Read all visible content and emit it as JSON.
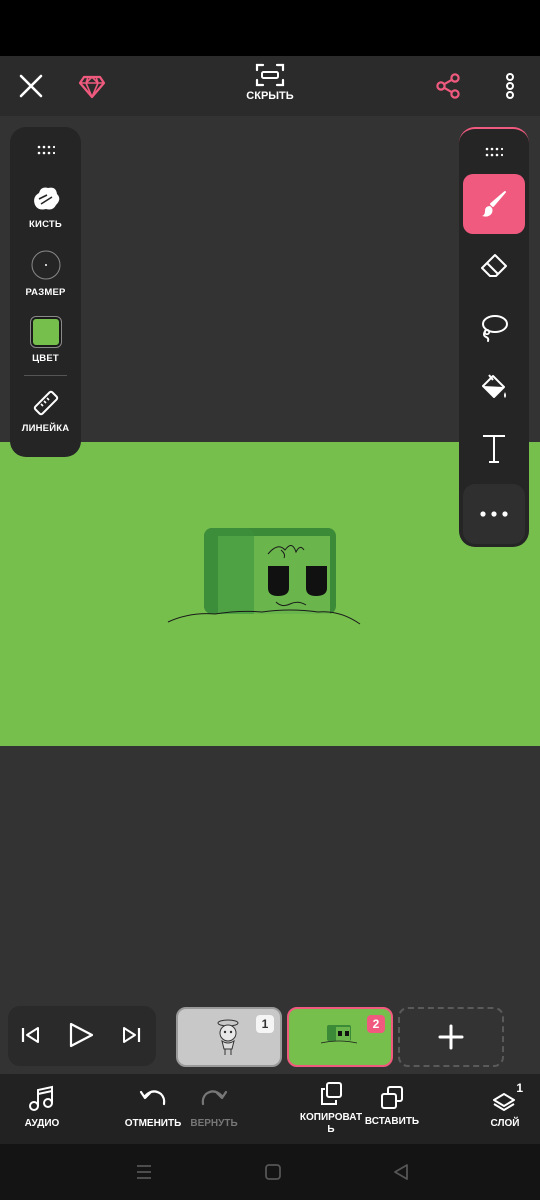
{
  "top_bar": {
    "close_icon": "close-icon",
    "premium_icon": "gem-icon",
    "hide_label": "СКРЫТЬ",
    "share_icon": "share-icon",
    "menu_icon": "more-vert-icon"
  },
  "left_tools": {
    "brush_label": "КИСТЬ",
    "size_label": "РАЗМЕР",
    "color_label": "ЦВЕТ",
    "ruler_label": "ЛИНЕЙКА",
    "current_color": "#76bf4d"
  },
  "right_tools": {
    "items": [
      "brush-icon",
      "eraser-icon",
      "lasso-icon",
      "fill-bucket-icon",
      "text-icon",
      "more-horiz-icon"
    ],
    "active": "brush-icon"
  },
  "timeline": {
    "frames": [
      {
        "number": "1"
      },
      {
        "number": "2"
      }
    ],
    "selected_frame": "2"
  },
  "bottom_toolbar": {
    "audio_label": "АУДИО",
    "undo_label": "ОТМЕНИТЬ",
    "redo_label": "ВЕРНУТЬ",
    "copy_label_1": "КОПИРОВАТ",
    "copy_label_2": "Ь",
    "paste_label": "ВСТАВИТЬ",
    "layers_label": "СЛОЙ",
    "layers_count": "1"
  },
  "colors": {
    "accent": "#f05a7e",
    "canvas_bg": "#76bf4d",
    "app_bg": "#333333"
  }
}
